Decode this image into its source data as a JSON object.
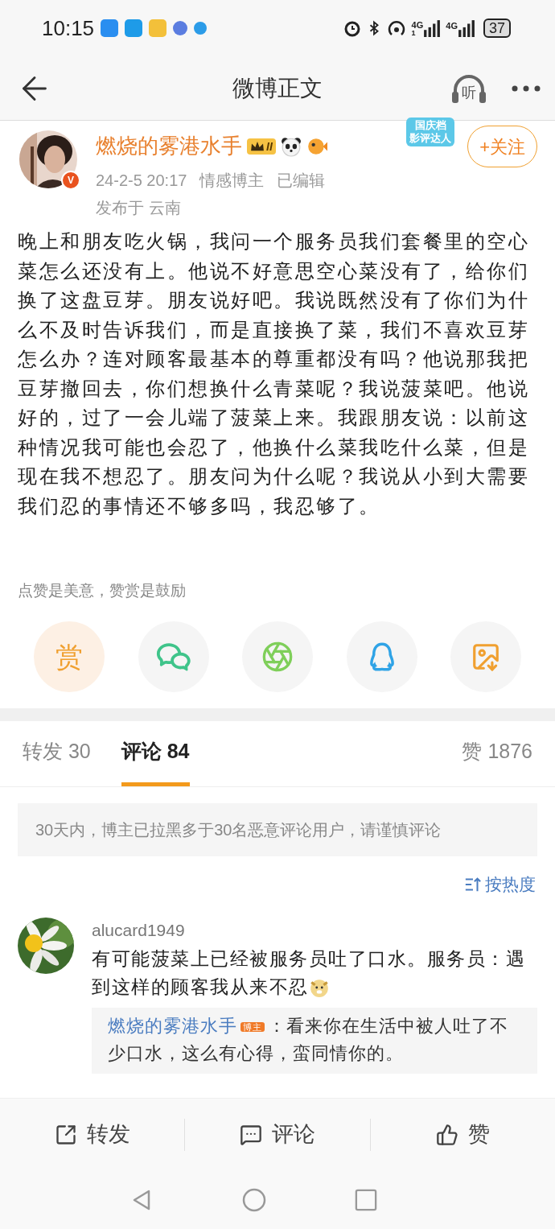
{
  "status_bar": {
    "time": "10:15",
    "network_1": "4G",
    "sim_1": "1",
    "network_2": "4G",
    "battery": "37"
  },
  "header": {
    "title": "微博正文",
    "listen_label": "听"
  },
  "author": {
    "name": "燃烧的雾港水手",
    "verified_mark": "V",
    "level_badge": "II",
    "meta": [
      "24-2-5 20:17",
      "情感博主",
      "已编辑"
    ],
    "location": "发布于 云南",
    "sticker_lines": [
      "国庆档",
      "影评达人"
    ],
    "follow_button": "+关注",
    "followed": false
  },
  "post": {
    "text": "晚上和朋友吃火锅，我问一个服务员我们套餐里的空心菜怎么还没有上。他说不好意思空心菜没有了，给你们换了这盘豆芽。朋友说好吧。我说既然没有了你们为什么不及时告诉我们，而是直接换了菜，我们不喜欢豆芽怎么办？连对顾客最基本的尊重都没有吗？他说那我把豆芽撤回去，你们想换什么青菜呢？我说菠菜吧。他说好的，过了一会儿端了菠菜上来。我跟朋友说：以前这种情况我可能也会忍了，他换什么菜我吃什么菜，但是现在我不想忍了。朋友问为什么呢？我说从小到大需要我们忍的事情还不够多吗，我忍够了。"
  },
  "reward_tip": "点赞是美意，赞赏是鼓励",
  "share_row": [
    {
      "kind": "reward",
      "label": "赏"
    },
    {
      "kind": "wechat"
    },
    {
      "kind": "moments"
    },
    {
      "kind": "qq"
    },
    {
      "kind": "save_image"
    }
  ],
  "tabs": [
    {
      "label": "转发 30",
      "selected": false
    },
    {
      "label": "评论 84",
      "selected": true
    },
    {
      "label": "赞 1876",
      "selected": false
    }
  ],
  "notice": "30天内，博主已拉黑多于30名恶意评论用户，请谨慎评论",
  "sort_label": "按热度",
  "comments": [
    {
      "user": "alucard1949",
      "text": "有可能菠菜上已经被服务员吐了口水。服务员：遇到这样的顾客我从来不忍",
      "reply": {
        "user": "燃烧的雾港水手",
        "tag": "博主",
        "text": "：看来你在生活中被人吐了不少口水，这么有心得，蛮同情你的。"
      }
    }
  ],
  "action_bar": [
    {
      "kind": "repost",
      "label": "转发"
    },
    {
      "kind": "comment",
      "label": "评论"
    },
    {
      "kind": "like",
      "label": "赞"
    }
  ]
}
